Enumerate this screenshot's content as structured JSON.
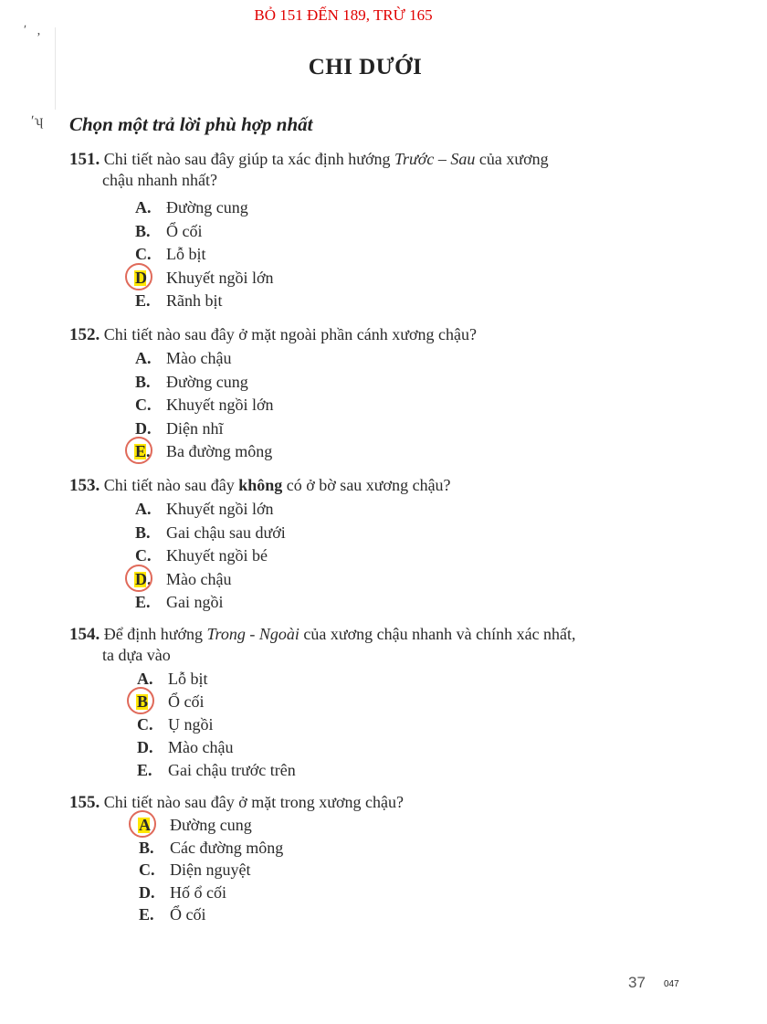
{
  "header_note": "BỎ 151 ĐẾN 189, TRỪ 165",
  "margin_marks": [
    "ʹ",
    "ʼ",
    "ʹʮ"
  ],
  "title": "CHI DƯỚI",
  "instruction": "Chọn một trả lời phù hợp nhất",
  "questions": [
    {
      "number": "151.",
      "stem_parts": [
        {
          "text": "Chi tiết nào sau đây giúp ta xác định hướng ",
          "style": "normal"
        },
        {
          "text": "Trước – Sau",
          "style": "italic"
        },
        {
          "text": " của xương",
          "style": "normal"
        }
      ],
      "continuation": "chậu nhanh nhất?",
      "options": [
        {
          "letter": "A.",
          "text": "Đường cung",
          "marked": false
        },
        {
          "letter": "B.",
          "text": "Ổ cối",
          "marked": false
        },
        {
          "letter": "C.",
          "text": "Lỗ bịt",
          "marked": false
        },
        {
          "letter": "D",
          "text": "Khuyết ngồi lớn",
          "marked": true
        },
        {
          "letter": "E.",
          "text": "Rãnh bịt",
          "marked": false
        }
      ]
    },
    {
      "number": "152.",
      "stem_parts": [
        {
          "text": "Chi tiết nào sau đây ở mặt ngoài phần cánh xương chậu?",
          "style": "normal"
        }
      ],
      "continuation": "",
      "options": [
        {
          "letter": "A.",
          "text": "Mào chậu",
          "marked": false
        },
        {
          "letter": "B.",
          "text": "Đường cung",
          "marked": false
        },
        {
          "letter": "C.",
          "text": "Khuyết ngồi lớn",
          "marked": false
        },
        {
          "letter": "D.",
          "text": "Diện nhĩ",
          "marked": false
        },
        {
          "letter": "E.",
          "text": "Ba đường mông",
          "marked": true
        }
      ]
    },
    {
      "number": "153.",
      "stem_parts": [
        {
          "text": "Chi tiết nào sau đây ",
          "style": "normal"
        },
        {
          "text": "không",
          "style": "bold"
        },
        {
          "text": " có ở bờ sau xương chậu?",
          "style": "normal"
        }
      ],
      "continuation": "",
      "options": [
        {
          "letter": "A.",
          "text": "Khuyết ngồi lớn",
          "marked": false
        },
        {
          "letter": "B.",
          "text": "Gai chậu sau dưới",
          "marked": false
        },
        {
          "letter": "C.",
          "text": "Khuyết ngồi bé",
          "marked": false
        },
        {
          "letter": "D.",
          "text": "Mào chậu",
          "marked": true
        },
        {
          "letter": "E.",
          "text": "Gai ngồi",
          "marked": false
        }
      ]
    },
    {
      "number": "154.",
      "stem_parts": [
        {
          "text": "Để định hướng ",
          "style": "normal"
        },
        {
          "text": "Trong - Ngoài",
          "style": "italic"
        },
        {
          "text": " của xương chậu nhanh và chính xác nhất,",
          "style": "normal"
        }
      ],
      "continuation": "ta dựa vào",
      "options": [
        {
          "letter": "A.",
          "text": "Lỗ bịt",
          "marked": false
        },
        {
          "letter": "B",
          "text": "Ổ cối",
          "marked": true
        },
        {
          "letter": "C.",
          "text": "Ụ ngồi",
          "marked": false
        },
        {
          "letter": "D.",
          "text": "Mào chậu",
          "marked": false
        },
        {
          "letter": "E.",
          "text": "Gai chậu trước trên",
          "marked": false
        }
      ]
    },
    {
      "number": "155.",
      "stem_parts": [
        {
          "text": "Chi tiết nào sau đây ở mặt trong xương chậu?",
          "style": "normal"
        }
      ],
      "continuation": "",
      "options": [
        {
          "letter": "A",
          "text": "Đường cung",
          "marked": true
        },
        {
          "letter": "B.",
          "text": "Các đường mông",
          "marked": false
        },
        {
          "letter": "C.",
          "text": "Diện nguyệt",
          "marked": false
        },
        {
          "letter": "D.",
          "text": "Hố ổ cối",
          "marked": false
        },
        {
          "letter": "E.",
          "text": "Ổ cối",
          "marked": false
        }
      ]
    }
  ],
  "page_number": "37",
  "page_code": "047"
}
